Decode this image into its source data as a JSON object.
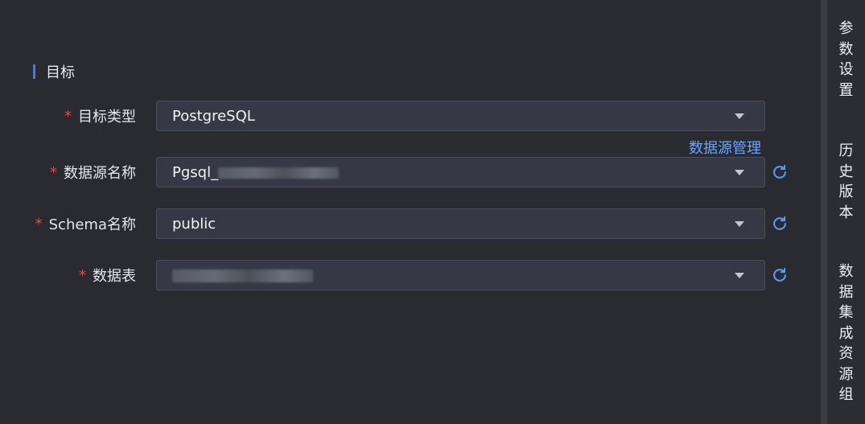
{
  "section": {
    "title": "目标"
  },
  "form": {
    "target_type": {
      "label": "目标类型",
      "value": "PostgreSQL"
    },
    "datasource_link": "数据源管理",
    "datasource_name": {
      "label": "数据源名称",
      "value_prefix": "Pgsql_"
    },
    "schema": {
      "label": "Schema名称",
      "value": "public"
    },
    "table": {
      "label": "数据表"
    },
    "required_mark": "*"
  },
  "sidebar": {
    "items": [
      {
        "label": [
          "参",
          "数",
          "设",
          "置"
        ]
      },
      {
        "label": [
          "历",
          "史",
          "版",
          "本"
        ]
      },
      {
        "label": [
          "数",
          "据",
          "集",
          "成",
          "资",
          "源",
          "组"
        ]
      }
    ]
  },
  "colors": {
    "accent": "#3d7cf0",
    "link": "#6aa4ff",
    "required": "#e5484d",
    "refresh": "#5b9bff"
  }
}
